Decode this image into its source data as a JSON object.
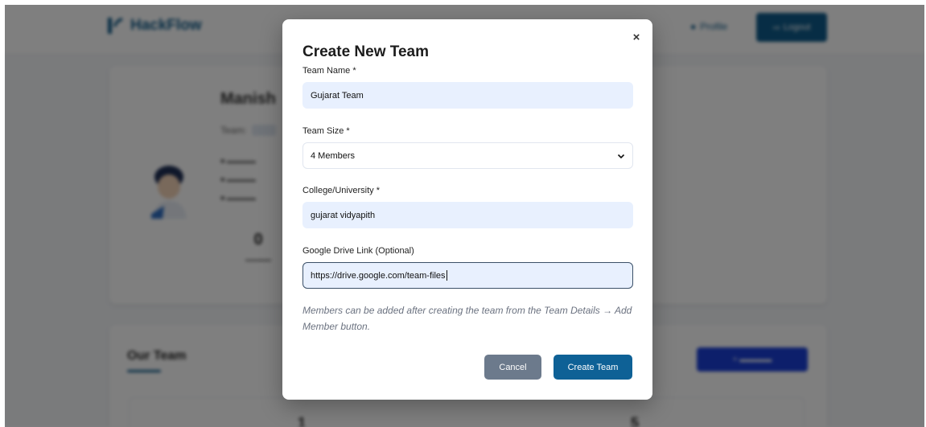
{
  "navbar": {
    "brand": "HackFlow",
    "profile_label": "Profile",
    "logout_label": "Logout"
  },
  "profile": {
    "name": "Manish",
    "team_label": "Team:",
    "stat_value": "0"
  },
  "team_section": {
    "heading": "Our Team",
    "count_left": "1",
    "count_right": "5"
  },
  "modal": {
    "title": "Create New Team",
    "close_glyph": "×",
    "team_name": {
      "label": "Team Name *",
      "value": "Gujarat Team"
    },
    "team_size": {
      "label": "Team Size *",
      "selected": "4 Members"
    },
    "college": {
      "label": "College/University *",
      "value": "gujarat vidyapith"
    },
    "drive_link": {
      "label": "Google Drive Link (Optional)",
      "value": "https://drive.google.com/team-files"
    },
    "hint": "Members can be added after creating the team from the Team Details → Add Member button.",
    "cancel_label": "Cancel",
    "create_label": "Create Team"
  },
  "colors": {
    "primary": "#0e6196",
    "cancel": "#6c7a8c",
    "filled_input": "#e8f0fe",
    "overlay": "rgba(0,0,0,0.5)"
  },
  "icons": {
    "close": "close-icon",
    "select": "chevron-down-icon",
    "brand": "logo-icon"
  }
}
